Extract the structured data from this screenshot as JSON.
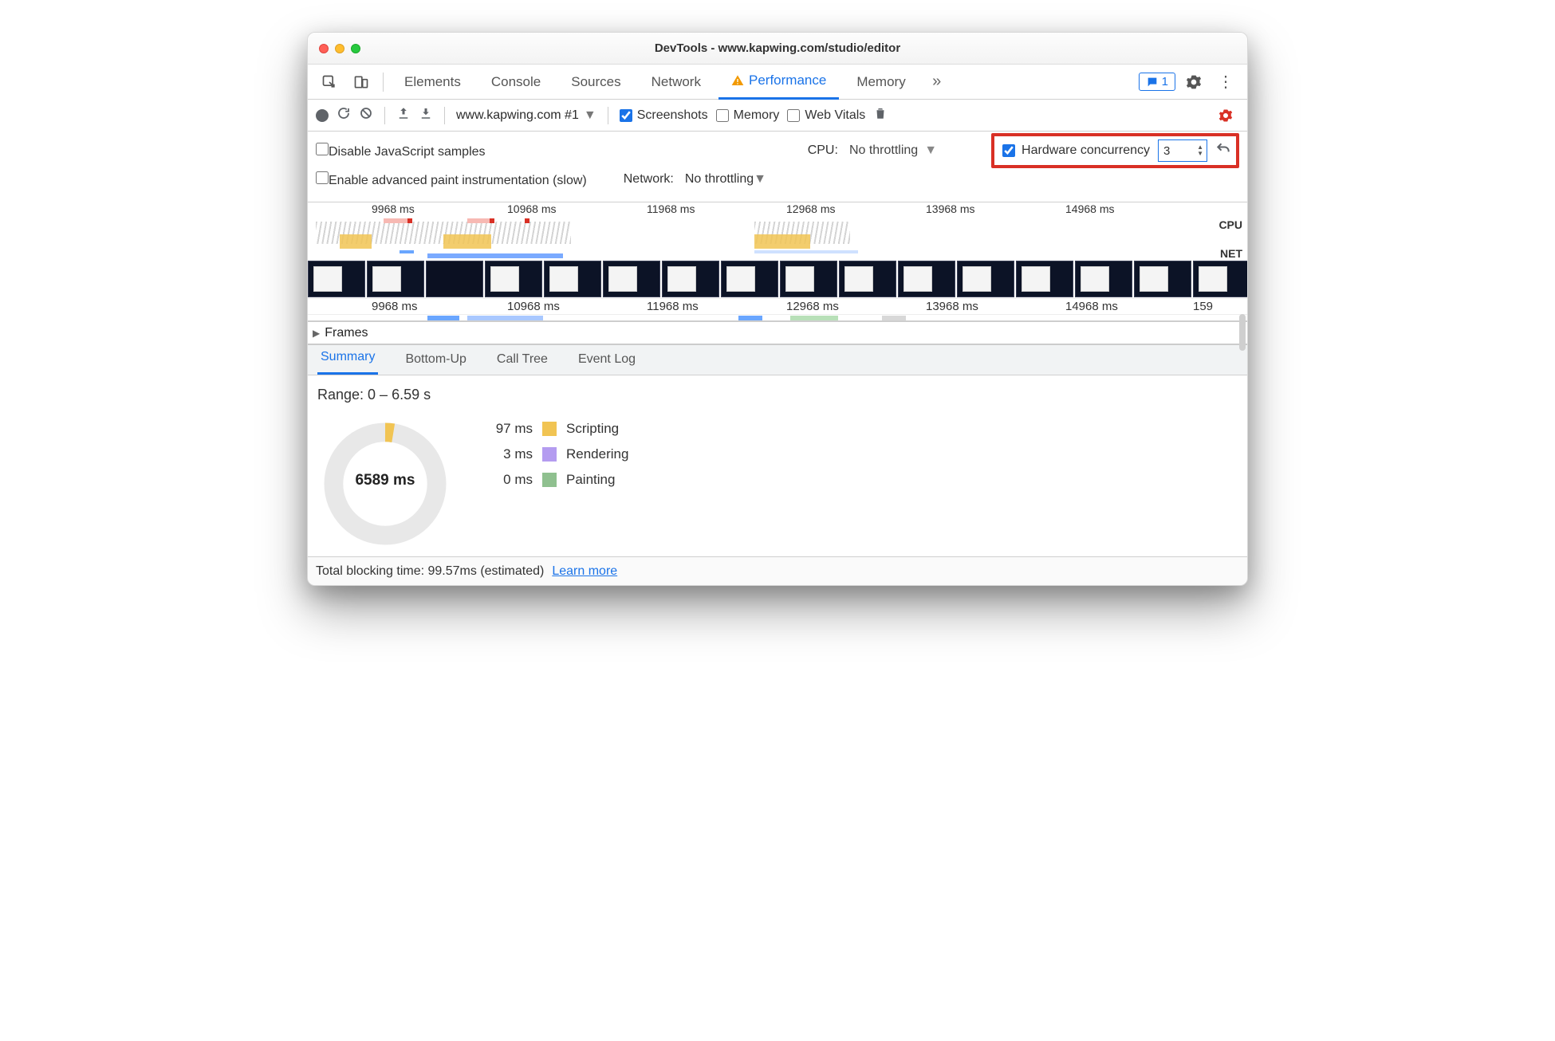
{
  "window_title": "DevTools - www.kapwing.com/studio/editor",
  "maintabs": {
    "elements": "Elements",
    "console": "Console",
    "sources": "Sources",
    "network": "Network",
    "performance": "Performance",
    "memory": "Memory"
  },
  "feedback_count": "1",
  "toolbar": {
    "page": "www.kapwing.com #1",
    "screenshots": "Screenshots",
    "memory": "Memory",
    "webvitals": "Web Vitals"
  },
  "opts": {
    "disable_js": "Disable JavaScript samples",
    "cpu_label": "CPU:",
    "cpu_val": "No throttling",
    "hw_label": "Hardware concurrency",
    "hw_val": "3",
    "enable_paint": "Enable advanced paint instrumentation (slow)",
    "net_label": "Network:",
    "net_val": "No throttling"
  },
  "ticks": [
    "9968 ms",
    "10968 ms",
    "11968 ms",
    "12968 ms",
    "13968 ms",
    "14968 ms"
  ],
  "ticks2": [
    "9968 ms",
    "10968 ms",
    "11968 ms",
    "12968 ms",
    "13968 ms",
    "14968 ms",
    "159"
  ],
  "lane_cpu": "CPU",
  "lane_net": "NET",
  "frames": "Frames",
  "btabs": {
    "summary": "Summary",
    "bottomup": "Bottom-Up",
    "calltree": "Call Tree",
    "eventlog": "Event Log"
  },
  "range": "Range: 0 – 6.59 s",
  "donut_center": "6589 ms",
  "legend": [
    {
      "ms": "97 ms",
      "color": "#f1c453",
      "label": "Scripting"
    },
    {
      "ms": "3 ms",
      "color": "#b49cf0",
      "label": "Rendering"
    },
    {
      "ms": "0 ms",
      "color": "#8fc08f",
      "label": "Painting"
    }
  ],
  "footer": {
    "tbt": "Total blocking time: 99.57ms (estimated)",
    "learn": "Learn more"
  }
}
